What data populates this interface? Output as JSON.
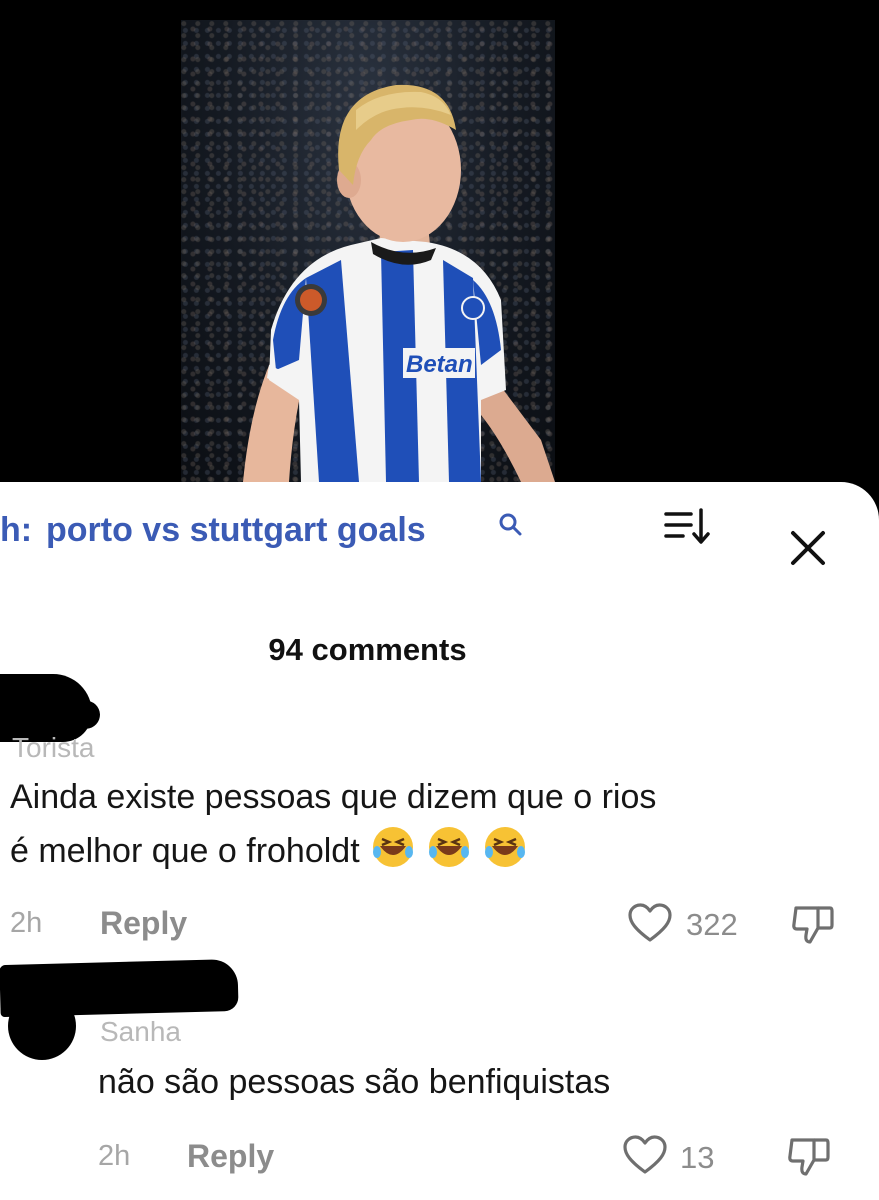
{
  "search": {
    "prefix": "h:",
    "query": "porto vs stuttgart goals"
  },
  "icons": {
    "search": "search-icon",
    "sort": "sort-icon",
    "close": "close-icon",
    "like": "heart-icon",
    "dislike": "thumbs-down-icon",
    "emoji": "rolling-on-floor-laughing-emoji"
  },
  "comments_header": {
    "count_text": "94 comments"
  },
  "comments": [
    {
      "username": "Torista",
      "text_line1": "Ainda existe pessoas que dizem que o rios",
      "text_line2": "é melhor que o froholdt",
      "time": "2h",
      "reply_label": "Reply",
      "likes": "322"
    },
    {
      "username": "Sanha",
      "text": "não são pessoas são benfiquistas",
      "time": "2h",
      "reply_label": "Reply",
      "likes": "13"
    }
  ],
  "colors": {
    "search_blue": "#3b5bb5",
    "text": "#161616",
    "meta_gray": "#8c8c8c",
    "porto_blue": "#1f4fb8"
  }
}
